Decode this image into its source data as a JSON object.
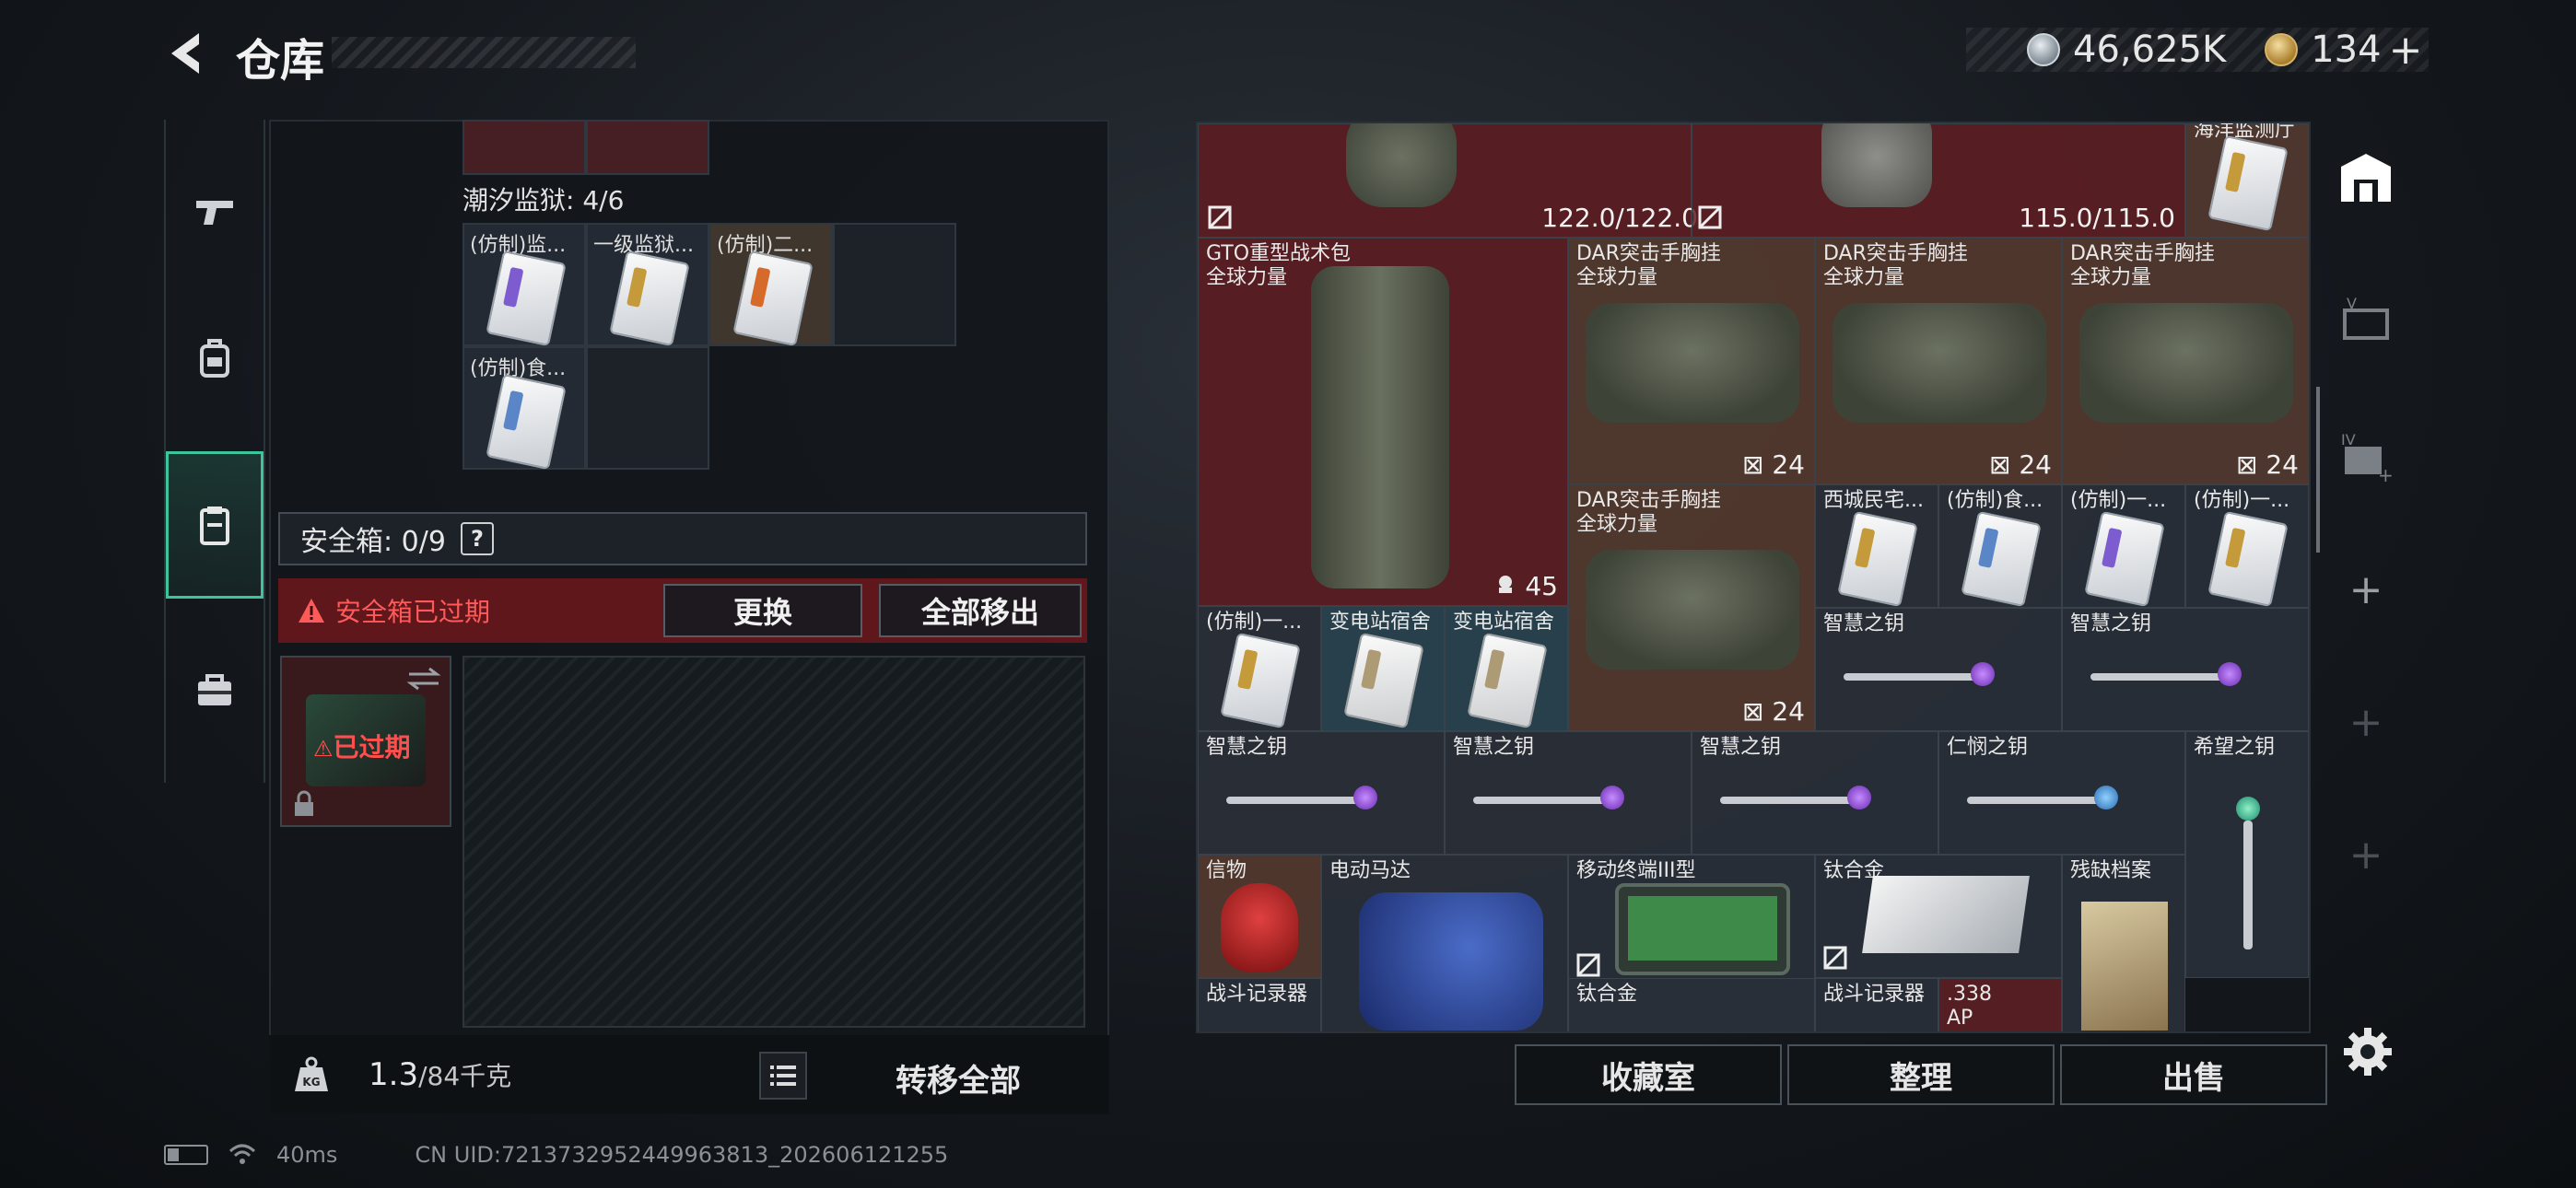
{
  "header": {
    "title": "仓库",
    "currency_silver": "46,625K",
    "currency_gold": "134",
    "plus": "+"
  },
  "left_nav": {
    "items": [
      "pistol-icon",
      "backpack-icon",
      "container-icon",
      "briefcase-icon"
    ],
    "active_index": 2
  },
  "left_panel": {
    "section_title": "潮汐监狱: 4/6",
    "cells": [
      {
        "label": "(仿制)监..."
      },
      {
        "label": "一级监狱..."
      },
      {
        "label": "(仿制)二..."
      },
      {
        "label": "(仿制)食..."
      }
    ],
    "safebox_label": "安全箱: 0/9",
    "help": "?",
    "expired_notice": "安全箱已过期",
    "replace_button": "更换",
    "remove_all_button": "全部移出",
    "thumb_expired": "已过期",
    "weight_current": "1.3",
    "weight_max": "/84千克",
    "transfer_all": "转移全部"
  },
  "right_panel": {
    "top_durability_1": "122.0/122.0",
    "top_durability_2": "115.0/115.0",
    "top_right_label": "海洋监测厅",
    "items": {
      "gto_name": "GTO重型战术包",
      "gto_sub": "全球力量",
      "gto_count": "45",
      "dar_name": "DAR突击手胸挂",
      "dar_sub": "全球力量",
      "dar_count": "24",
      "xicheng": "西城民宅...",
      "fang_shi": "(仿制)食...",
      "fang_yi": "(仿制)一...",
      "bdz_1": "变电站宿舍",
      "bdz_2": "变电站宿舍",
      "zhihui": "智慧之钥",
      "renmin": "仁悯之钥",
      "xiwang": "希望之钥",
      "xinwu": "信物",
      "motor": "电动马达",
      "mobile": "移动终端III型",
      "alloy": "钛合金",
      "archive": "残缺档案",
      "battle_rec": "战斗记录器",
      "ammo": ".338",
      "ammo_sub": "AP"
    }
  },
  "bottom_buttons": {
    "collection": "收藏室",
    "organize": "整理",
    "sell": "出售"
  },
  "status": {
    "ping": "40ms",
    "uid": "CN UID:7213732952449963813_202606121255"
  },
  "colors": {
    "accent_green": "#3cc49a",
    "warning_red": "#ff5a5a",
    "cell_red": "#62202499"
  }
}
